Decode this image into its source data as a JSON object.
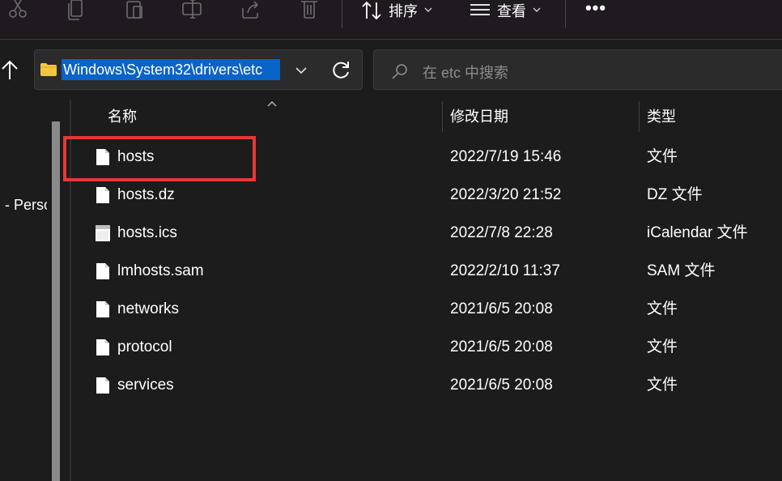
{
  "toolbar": {
    "sort_label": "排序",
    "view_label": "查看",
    "icons": [
      "cut-icon",
      "copy-icon",
      "paste-icon",
      "rename-icon",
      "share-icon",
      "delete-icon"
    ]
  },
  "address_bar": {
    "path": "Windows\\System32\\drivers\\etc"
  },
  "search": {
    "placeholder": "在 etc 中搜索"
  },
  "nav": {
    "item_label": "- Perso"
  },
  "columns": {
    "name": "名称",
    "modified": "修改日期",
    "type": "类型"
  },
  "files": [
    {
      "name": "hosts",
      "modified": "2022/7/19 15:46",
      "type": "文件",
      "icon": "file-icon"
    },
    {
      "name": "hosts.dz",
      "modified": "2022/3/20 21:52",
      "type": "DZ 文件",
      "icon": "file-icon"
    },
    {
      "name": "hosts.ics",
      "modified": "2022/7/8 22:28",
      "type": "iCalendar 文件",
      "icon": "calendar-file-icon"
    },
    {
      "name": "lmhosts.sam",
      "modified": "2022/2/10 11:37",
      "type": "SAM 文件",
      "icon": "file-icon"
    },
    {
      "name": "networks",
      "modified": "2021/6/5 20:08",
      "type": "文件",
      "icon": "file-icon"
    },
    {
      "name": "protocol",
      "modified": "2021/6/5 20:08",
      "type": "文件",
      "icon": "file-icon"
    },
    {
      "name": "services",
      "modified": "2021/6/5 20:08",
      "type": "文件",
      "icon": "file-icon"
    }
  ],
  "colors": {
    "background": "#1c1c1c",
    "selection": "#0a64c8",
    "highlight_box": "#e53935",
    "folder": "#f5c542"
  }
}
